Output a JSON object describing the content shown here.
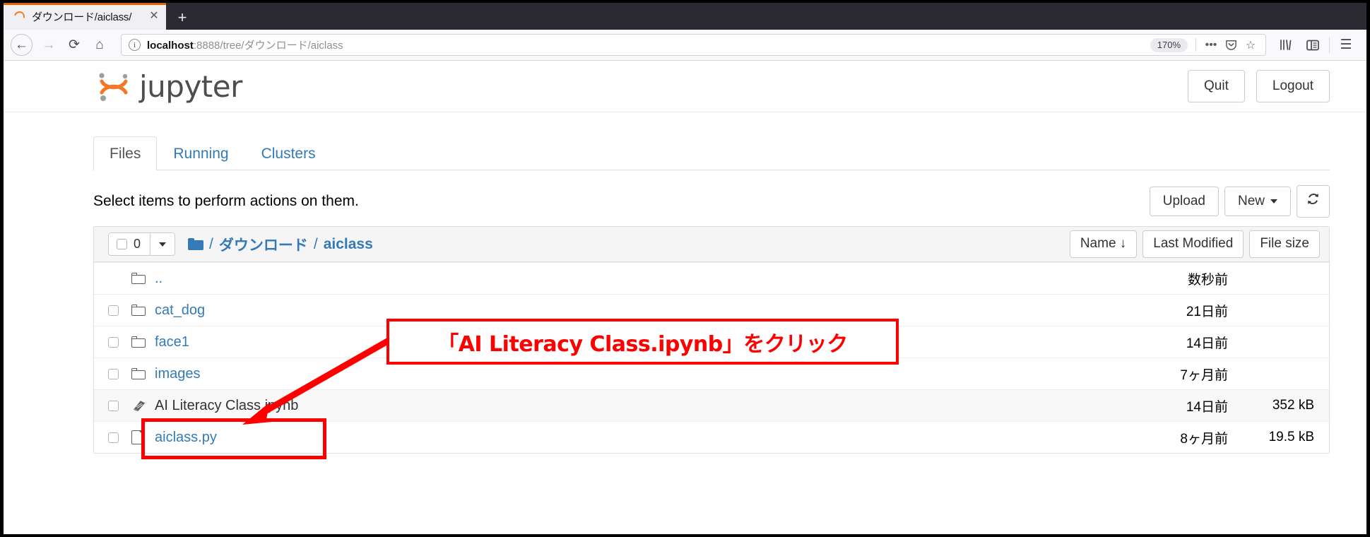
{
  "browser": {
    "tab": {
      "title": "ダウンロード/aiclass/",
      "favicon": "jupyter-favicon",
      "close_label": "✕"
    },
    "new_tab_label": "+",
    "nav": {
      "back": "←",
      "forward": "→",
      "reload": "⟳",
      "home": "⌂"
    },
    "url": {
      "host": "localhost",
      "rest": ":8888/tree/ダウンロード/aiclass",
      "info_icon": "ⓘ"
    },
    "zoom_level": "170%",
    "url_actions": {
      "more": "•••",
      "pocket": "pocket-icon",
      "bookmark": "☆"
    },
    "toolbar_right": {
      "library": "library-icon",
      "sidebar": "sidebar-icon",
      "menu": "☰"
    }
  },
  "jupyter": {
    "logo_text": "jupyter",
    "header_buttons": {
      "quit": "Quit",
      "logout": "Logout"
    },
    "tabs": [
      {
        "label": "Files",
        "active": true
      },
      {
        "label": "Running",
        "active": false
      },
      {
        "label": "Clusters",
        "active": false
      }
    ],
    "actions": {
      "note": "Select items to perform actions on them.",
      "upload": "Upload",
      "new": "New",
      "refresh": "refresh-icon"
    },
    "toolbar": {
      "selected_count": "0",
      "dropdown_caret": "▾",
      "breadcrumb": [
        {
          "label": "folder-icon",
          "type": "icon"
        },
        {
          "label": "ダウンロード",
          "type": "link"
        },
        {
          "label": "aiclass",
          "type": "link"
        }
      ],
      "breadcrumb_separator": "/",
      "sort_buttons": [
        {
          "label": "Name",
          "arrow": "↓"
        },
        {
          "label": "Last Modified",
          "arrow": ""
        },
        {
          "label": "File size",
          "arrow": ""
        }
      ]
    },
    "columns": {
      "name": "Name",
      "last_modified": "Last Modified",
      "file_size": "File size"
    },
    "files": [
      {
        "name": "..",
        "icon": "folder-icon",
        "modified": "数秒前",
        "size": "",
        "checkbox": false,
        "highlight": false,
        "link": true
      },
      {
        "name": "cat_dog",
        "icon": "folder-icon",
        "modified": "21日前",
        "size": "",
        "checkbox": true,
        "highlight": false,
        "link": true
      },
      {
        "name": "face1",
        "icon": "folder-icon",
        "modified": "14日前",
        "size": "",
        "checkbox": true,
        "highlight": false,
        "link": true
      },
      {
        "name": "images",
        "icon": "folder-icon",
        "modified": "7ヶ月前",
        "size": "",
        "checkbox": true,
        "highlight": false,
        "link": true
      },
      {
        "name": "AI Literacy Class.ipynb",
        "icon": "notebook-icon",
        "modified": "14日前",
        "size": "352 kB",
        "checkbox": true,
        "highlight": true,
        "link": false
      },
      {
        "name": "aiclass.py",
        "icon": "file-icon",
        "modified": "8ヶ月前",
        "size": "19.5 kB",
        "checkbox": true,
        "highlight": false,
        "link": true
      }
    ]
  },
  "annotation": {
    "callout_text": "「AI Literacy Class.ipynb」をクリック",
    "color": "#fe0000"
  }
}
